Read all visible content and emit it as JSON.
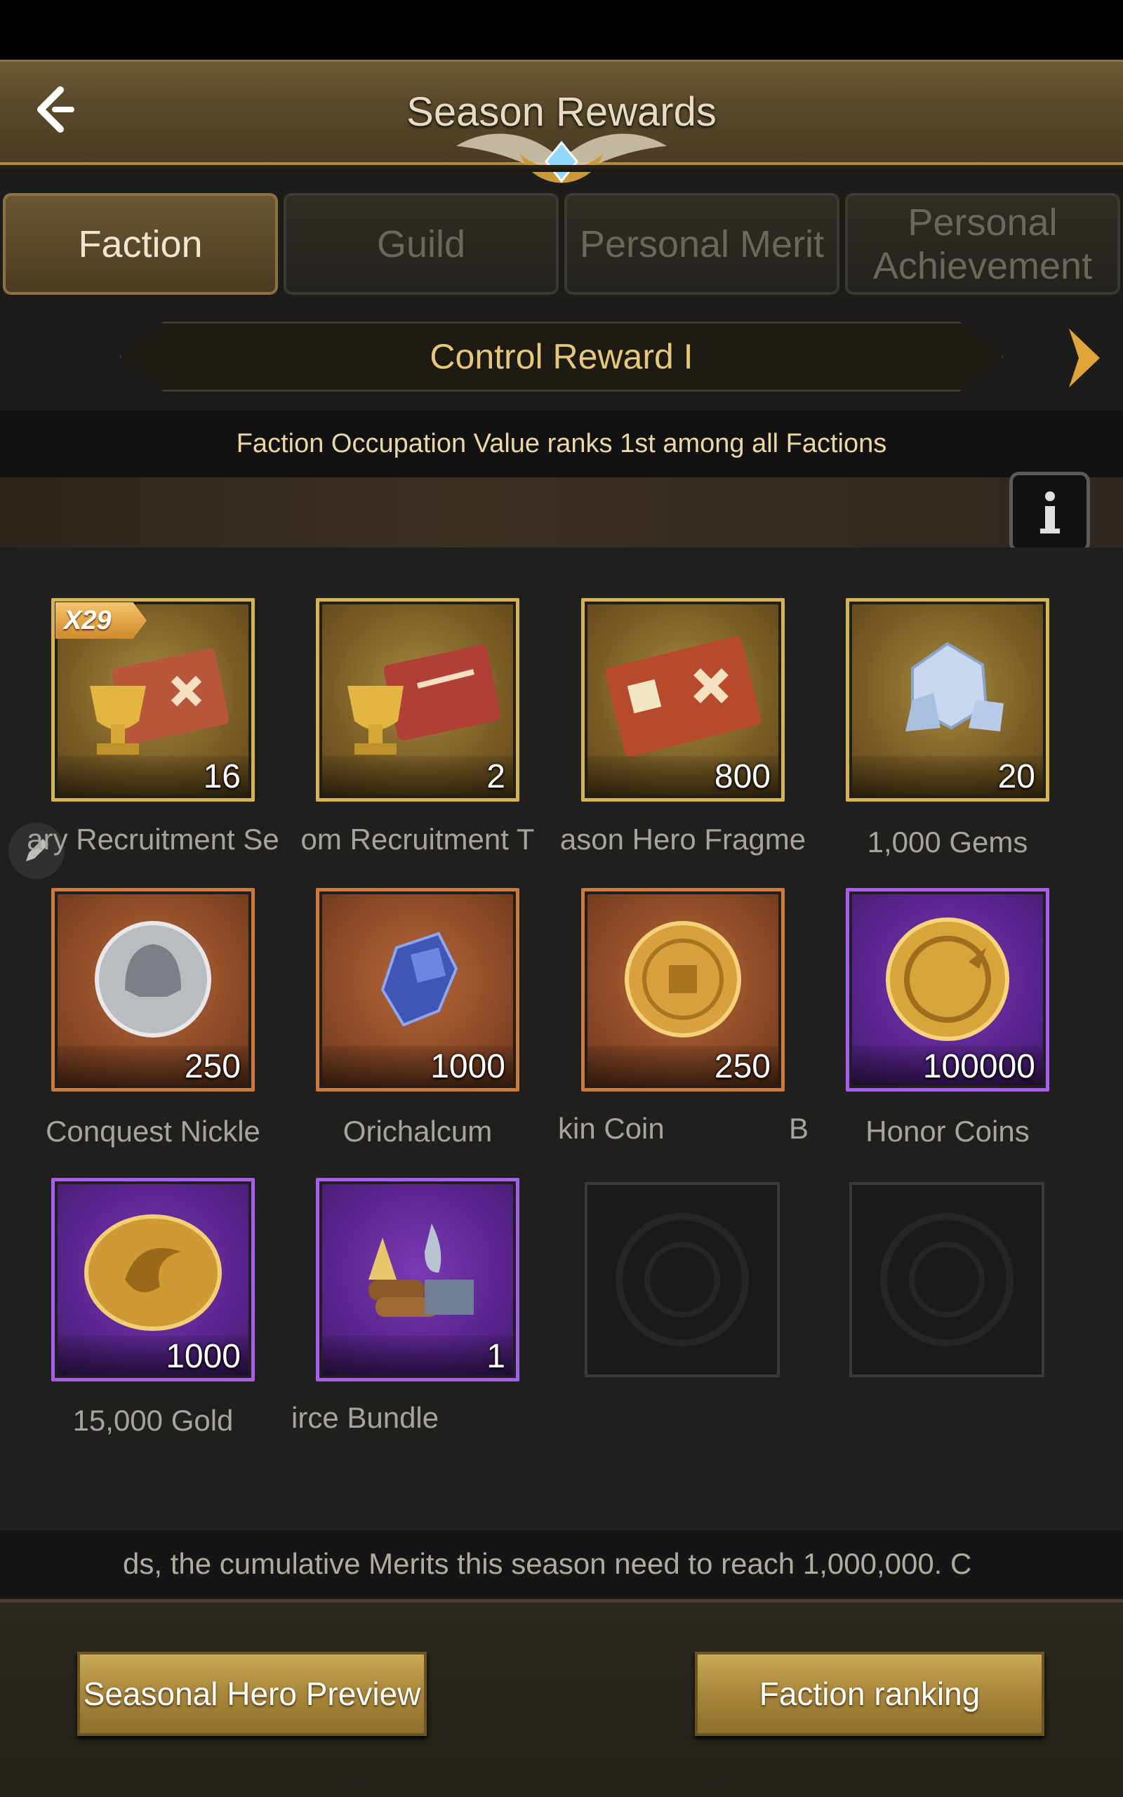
{
  "header": {
    "title": "Season Rewards",
    "back_icon": "back-arrow-icon"
  },
  "tabs": [
    {
      "label": "Faction",
      "active": true
    },
    {
      "label": "Guild",
      "active": false
    },
    {
      "label": "Personal Merit",
      "active": false
    },
    {
      "label": "Personal Achievement",
      "active": false
    }
  ],
  "control": {
    "label": "Control Reward I"
  },
  "condition": "Faction Occupation Value ranks 1st among all Factions",
  "rewards": [
    {
      "label": "ary Recruitment Se",
      "count": "16",
      "badge": "X29",
      "tier": "gold",
      "icon": "legendary-recruitment-ticket-icon"
    },
    {
      "label": "om Recruitment T",
      "count": "2",
      "tier": "gold",
      "icon": "random-recruitment-ticket-icon"
    },
    {
      "label": "ason Hero Fragme",
      "count": "800",
      "tier": "gold",
      "icon": "hero-fragment-ticket-icon"
    },
    {
      "label": "1,000 Gems",
      "count": "20",
      "tier": "gold",
      "icon": "gems-icon"
    },
    {
      "label": "Conquest Nickle",
      "count": "250",
      "tier": "orange",
      "icon": "conquest-nickle-icon"
    },
    {
      "label": "Orichalcum",
      "count": "1000",
      "tier": "orange",
      "icon": "orichalcum-icon"
    },
    {
      "label": "kin Coin",
      "label_tail": "B",
      "count": "250",
      "tier": "orange",
      "icon": "skin-coin-icon"
    },
    {
      "label": "Honor Coins",
      "count": "100000",
      "tier": "purple",
      "icon": "honor-coin-icon"
    },
    {
      "label": "15,000 Gold",
      "count": "1000",
      "tier": "purple",
      "icon": "gold-coin-icon"
    },
    {
      "label": "irce Bundle",
      "count": "1",
      "tier": "purple",
      "icon": "resource-bundle-icon"
    }
  ],
  "scroll_note": "ds, the cumulative Merits this season need to reach 1,000,000. C",
  "footer": {
    "preview_button": "Seasonal Hero Preview",
    "ranking_button": "Faction ranking"
  },
  "colors": {
    "accent_gold": "#e7c879",
    "gold_frame": "#d6b350",
    "orange_frame": "#d0783a",
    "purple_frame": "#a85cf0"
  }
}
